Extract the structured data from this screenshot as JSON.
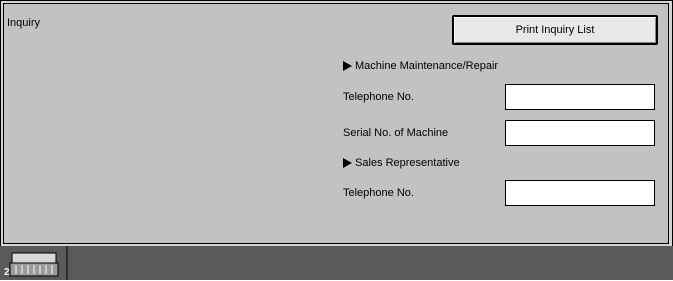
{
  "screen": {
    "title": "Inquiry",
    "print_button_label": "Print Inquiry List"
  },
  "maintenance": {
    "heading": "Machine Maintenance/Repair",
    "telephone_label": "Telephone No.",
    "telephone_value": "",
    "serial_label": "Serial No. of Machine",
    "serial_value": ""
  },
  "sales": {
    "heading": "Sales Representative",
    "telephone_label": "Telephone No.",
    "telephone_value": ""
  },
  "status_bar": {
    "tray_number": "2",
    "tray_icon": "paper-tray-icon"
  }
}
